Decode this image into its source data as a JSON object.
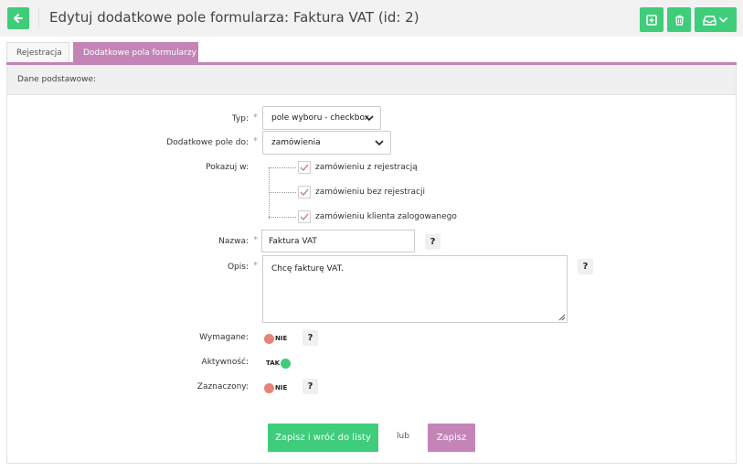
{
  "header": {
    "title": "Edytuj dodatkowe pole formularza: Faktura VAT (id: 2)",
    "back_icon": "arrow-left-icon",
    "actions": [
      {
        "icon": "add-square-icon"
      },
      {
        "icon": "trash-icon"
      },
      {
        "icon": "inbox-dropdown-icon"
      }
    ]
  },
  "tabs": [
    {
      "label": "Rejestracja",
      "active": false
    },
    {
      "label": "Dodatkowe pola formularzy",
      "active": true
    }
  ],
  "section": {
    "title": "Dane podstawowe:"
  },
  "form": {
    "required_mark": "*",
    "type": {
      "label": "Typ:",
      "value": "pole wyboru - checkbox"
    },
    "field_for": {
      "label": "Dodatkowe pole do:",
      "value": "zamówienia"
    },
    "show_in": {
      "label": "Pokazuj w:",
      "options": [
        {
          "label": "zamówieniu z rejestracją",
          "checked": true
        },
        {
          "label": "zamówieniu bez rejestracji",
          "checked": true
        },
        {
          "label": "zamówieniu klienta zalogowanego",
          "checked": true
        }
      ]
    },
    "name": {
      "label": "Nazwa:",
      "value": "Faktura VAT",
      "help": "?"
    },
    "description": {
      "label": "Opis:",
      "value": "Chcę fakturę VAT.",
      "help": "?"
    },
    "required": {
      "label": "Wymagane:",
      "state": "NIE",
      "on": false,
      "help": "?"
    },
    "active": {
      "label": "Aktywność:",
      "state": "TAK",
      "on": true
    },
    "checked": {
      "label": "Zaznaczony:",
      "state": "NIE",
      "on": false,
      "help": "?"
    }
  },
  "buttons": {
    "save_return": "Zapisz i wróć do listy",
    "or": "lub",
    "save": "Zapisz"
  },
  "colors": {
    "green": "#3fcc7b",
    "purple": "#c484b7",
    "toggle_off": "#e8837a",
    "toggle_on": "#3fcc7b"
  }
}
